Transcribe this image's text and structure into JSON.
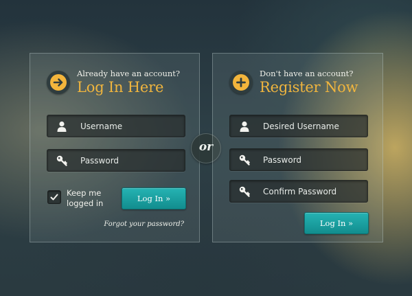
{
  "login": {
    "subtitle": "Already have an account?",
    "title": "Log In Here",
    "username_placeholder": "Username",
    "password_placeholder": "Password",
    "keep_logged_in": "Keep me logged in",
    "keep_logged_in_checked": true,
    "button_label": "Log In »",
    "forgot_link": "Forgot your password?"
  },
  "divider": {
    "label": "or"
  },
  "register": {
    "subtitle": "Don't have an account?",
    "title": "Register Now",
    "username_placeholder": "Desired Username",
    "password_placeholder": "Password",
    "confirm_placeholder": "Confirm Password",
    "button_label": "Log In »"
  },
  "icons": {
    "login_header": "arrow-right-circle-icon",
    "register_header": "plus-circle-icon",
    "user": "user-icon",
    "key": "key-icon",
    "check": "checkmark-icon"
  },
  "colors": {
    "accent": "#f0b53e",
    "button": "#1a9fa0"
  }
}
